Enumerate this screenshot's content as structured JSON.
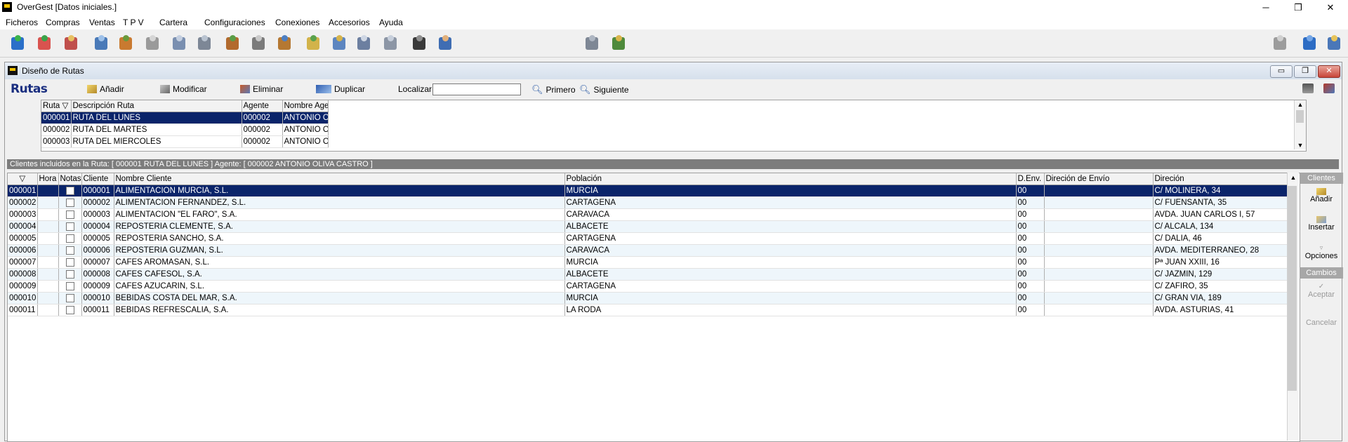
{
  "app": {
    "title": "OverGest  [Datos iniciales.]"
  },
  "menu": [
    "Ficheros",
    "Compras",
    "Ventas",
    "T P V",
    "Cartera",
    "Configuraciones",
    "Conexiones",
    "Accesorios",
    "Ayuda"
  ],
  "child": {
    "title": "Diseño de Rutas"
  },
  "rutas": {
    "label": "Rutas",
    "add": "Añadir",
    "modify": "Modificar",
    "delete": "Eliminar",
    "duplicate": "Duplicar",
    "localizar": "Localizar:",
    "localizar_value": "",
    "first": "Primero",
    "next": "Siguiente",
    "columns": [
      "Ruta ▽",
      "Descripción Ruta",
      "Agente",
      "Nombre Agente"
    ],
    "rows": [
      [
        "000001",
        "RUTA DEL LUNES",
        "000002",
        "ANTONIO OLIV"
      ],
      [
        "000002",
        "RUTA DEL MARTES",
        "000002",
        "ANTONIO OLIV"
      ],
      [
        "000003",
        "RUTA DEL MIERCOLES",
        "000002",
        "ANTONIO OLIV"
      ]
    ]
  },
  "clients": {
    "header": "Clientes incluidos en la Ruta: [ 000001 RUTA DEL LUNES ]   Agente: [ 000002 ANTONIO OLIVA CASTRO ]",
    "columns": [
      "▽",
      "Hora",
      "Notas",
      "Cliente",
      "Nombre Cliente",
      "Población",
      "D.Env.",
      "Direción de Envío",
      "Direción"
    ],
    "rows": [
      [
        "000001",
        "",
        "",
        "000001",
        "ALIMENTACION MURCIA, S.L.",
        "MURCIA",
        "00",
        "",
        "C/ MOLINERA, 34"
      ],
      [
        "000002",
        "",
        "",
        "000002",
        "ALIMENTACION FERNANDEZ, S.L.",
        "CARTAGENA",
        "00",
        "",
        "C/ FUENSANTA, 35"
      ],
      [
        "000003",
        "",
        "",
        "000003",
        "ALIMENTACION \"EL FARO\", S.A.",
        "CARAVACA",
        "00",
        "",
        "AVDA. JUAN CARLOS I, 57"
      ],
      [
        "000004",
        "",
        "",
        "000004",
        "REPOSTERIA CLEMENTE, S.A.",
        "ALBACETE",
        "00",
        "",
        "C/ ALCALA, 134"
      ],
      [
        "000005",
        "",
        "",
        "000005",
        "REPOSTERIA SANCHO, S.A.",
        "CARTAGENA",
        "00",
        "",
        "C/ DALIA, 46"
      ],
      [
        "000006",
        "",
        "",
        "000006",
        "REPOSTERIA GUZMAN, S.L.",
        "CARAVACA",
        "00",
        "",
        "AVDA. MEDITERRANEO, 28"
      ],
      [
        "000007",
        "",
        "",
        "000007",
        "CAFES AROMASAN, S.L.",
        "MURCIA",
        "00",
        "",
        "Pª JUAN XXIII, 16"
      ],
      [
        "000008",
        "",
        "",
        "000008",
        "CAFES CAFESOL, S.A.",
        "ALBACETE",
        "00",
        "",
        "C/ JAZMIN, 129"
      ],
      [
        "000009",
        "",
        "",
        "000009",
        "CAFES AZUCARIN, S.L.",
        "CARTAGENA",
        "00",
        "",
        "C/ ZAFIRO, 35"
      ],
      [
        "000010",
        "",
        "",
        "000010",
        "BEBIDAS COSTA DEL MAR, S.A.",
        "MURCIA",
        "00",
        "",
        "C/ GRAN VIA, 189"
      ],
      [
        "000011",
        "",
        "",
        "000011",
        "BEBIDAS REFRESCALIA, S.A.",
        "LA RODA",
        "00",
        "",
        "AVDA. ASTURIAS, 41"
      ]
    ]
  },
  "side": {
    "clientes": "Clientes",
    "add": "Añadir",
    "insert": "Insertar",
    "options": "Opciones",
    "cambios": "Cambios",
    "accept": "Aceptar",
    "cancel": "Cancelar"
  },
  "colors": {
    "selection": "#0a246a",
    "rutas_label": "#1b2f80",
    "header_gray": "#7d7d7d"
  }
}
